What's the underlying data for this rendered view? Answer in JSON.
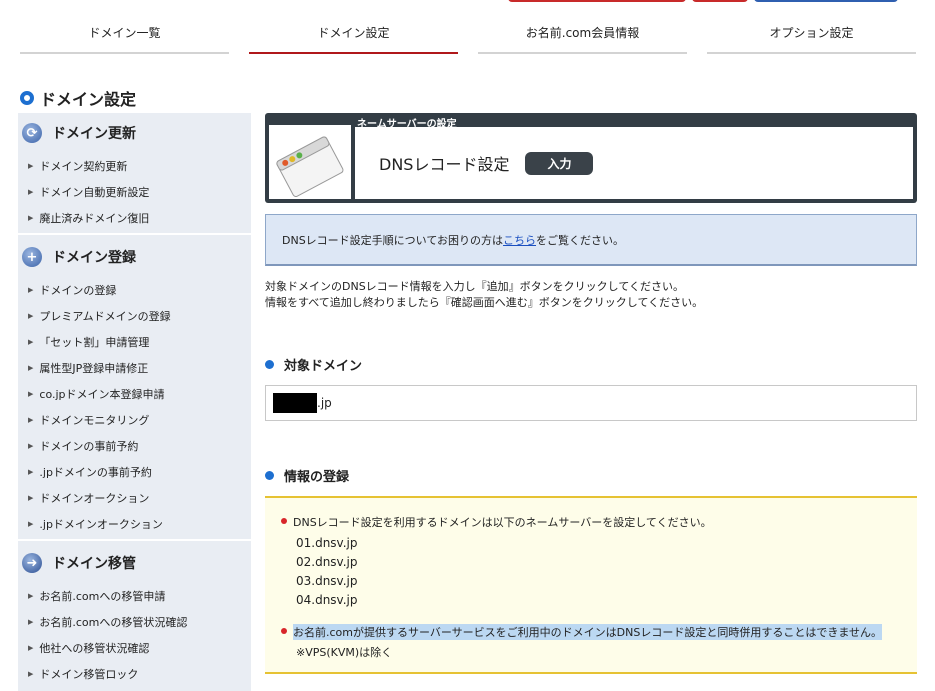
{
  "tabs": [
    {
      "label": "ドメイン一覧"
    },
    {
      "label": "ドメイン設定"
    },
    {
      "label": "お名前.com会員情報"
    },
    {
      "label": "オプション設定"
    }
  ],
  "page_heading": "ドメイン設定",
  "sidebar": {
    "groups": [
      {
        "title": "ドメイン更新",
        "items": [
          "ドメイン契約更新",
          "ドメイン自動更新設定",
          "廃止済みドメイン復旧"
        ]
      },
      {
        "title": "ドメイン登録",
        "items": [
          "ドメインの登録",
          "プレミアムドメインの登録",
          "「セット割」申請管理",
          "属性型JP登録申請修正",
          "co.jpドメイン本登録申請",
          "ドメインモニタリング",
          "ドメインの事前予約",
          ".jpドメインの事前予約",
          "ドメインオークション",
          ".jpドメインオークション"
        ]
      },
      {
        "title": "ドメイン移管",
        "items": [
          "お名前.comへの移管申請",
          "お名前.comへの移管状況確認",
          "他社への移管状況確認",
          "ドメイン移管ロック"
        ]
      }
    ]
  },
  "header_card": {
    "tag": "ネームサーバーの設定",
    "title": "DNSレコード設定",
    "badge": "入力"
  },
  "info": {
    "prefix": "DNSレコード設定手順についてお困りの方は",
    "link": "こちら",
    "suffix": "をご覧ください。"
  },
  "description": {
    "line1": "対象ドメインのDNSレコード情報を入力し『追加』ボタンをクリックしてください。",
    "line2": "情報をすべて追加し終わりましたら『確認画面へ進む』ボタンをクリックしてください。"
  },
  "target_domain": {
    "title": "対象ドメイン",
    "suffix": ".jp"
  },
  "registration": {
    "title": "情報の登録",
    "note1": "DNSレコード設定を利用するドメインは以下のネームサーバーを設定してください。",
    "nameservers": [
      "01.dnsv.jp",
      "02.dnsv.jp",
      "03.dnsv.jp",
      "04.dnsv.jp"
    ],
    "note2": "お名前.comが提供するサーバーサービスをご利用中のドメインはDNSレコード設定と同時併用することはできません。",
    "note2_sub": "※VPS(KVM)は除く"
  }
}
